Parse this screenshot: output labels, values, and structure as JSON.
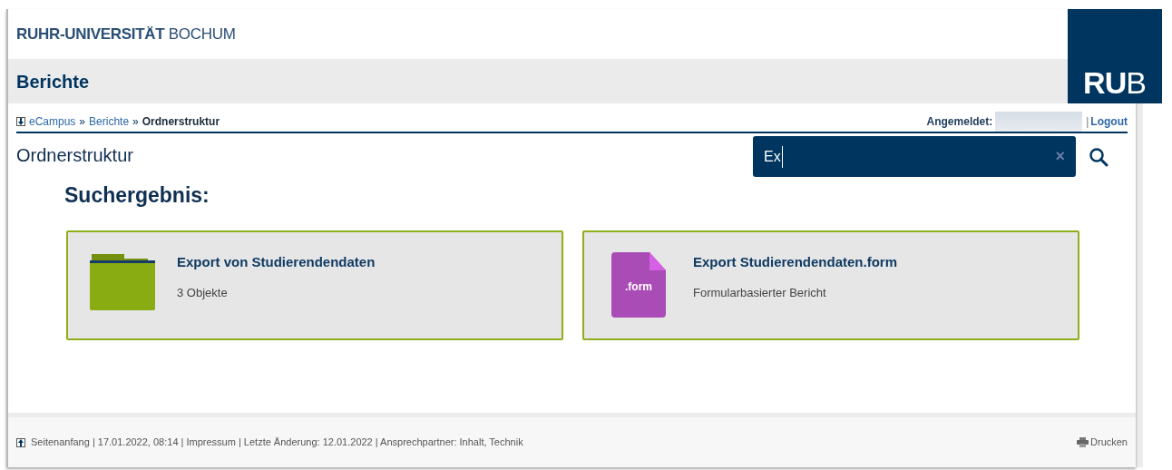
{
  "header": {
    "university": "RUHR-UNIVERSITÄT",
    "city": "BOCHUM",
    "logo_bold": "RU",
    "logo_light": "B"
  },
  "title": "Berichte",
  "breadcrumb": {
    "separator": "»",
    "items": [
      {
        "label": "eCampus",
        "current": false
      },
      {
        "label": "Berichte",
        "current": false
      },
      {
        "label": "Ordnerstruktur",
        "current": true
      }
    ]
  },
  "login": {
    "label": "Angemeldet:",
    "separator": "|",
    "logout": "Logout"
  },
  "page_heading": "Ordnerstruktur",
  "search": {
    "value": "Ex",
    "clear": "×"
  },
  "results_heading": "Suchergebnis:",
  "results": [
    {
      "kind": "folder",
      "title": "Export von Studierendendaten",
      "subtitle": "3 Objekte"
    },
    {
      "kind": "form",
      "title": "Export Studierendendaten.form",
      "subtitle": "Formularbasierter Bericht",
      "file_label": ".form"
    }
  ],
  "footer": {
    "text": "Seitenanfang | 17.01.2022, 08:14 | Impressum | Letzte Änderung: 12.01.2022 | Ansprechpartner: Inhalt, Technik",
    "print": "Drucken"
  }
}
